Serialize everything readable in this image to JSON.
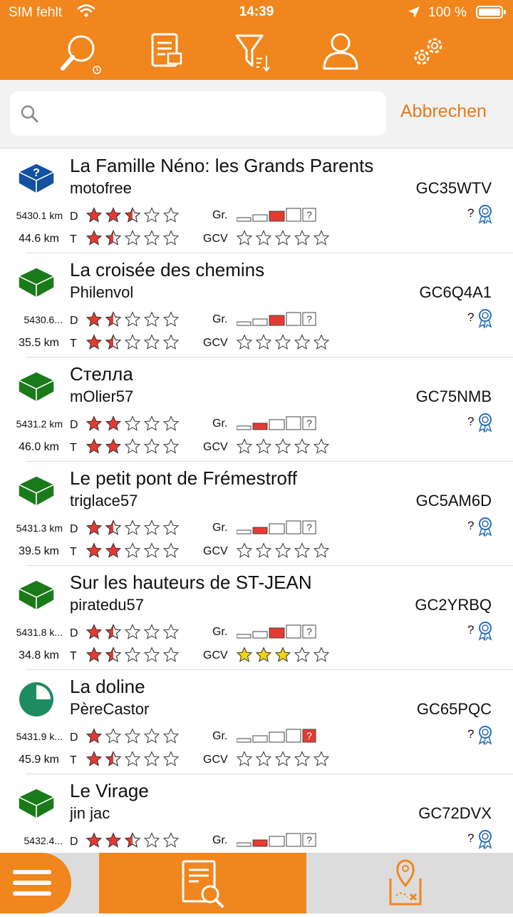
{
  "status": {
    "carrier": "SIM fehlt",
    "time": "14:39",
    "battery": "100 %"
  },
  "toolbar": {
    "buttons": [
      "search-history-icon",
      "cache-list-icon",
      "filter-sort-icon",
      "user-icon",
      "settings-icon"
    ]
  },
  "search": {
    "value": "",
    "placeholder": "",
    "cancel_label": "Abbrechen"
  },
  "labels": {
    "difficulty": "D",
    "terrain": "T",
    "size": "Gr.",
    "gcvote": "GCV",
    "favorites": "?"
  },
  "colors": {
    "accent": "#f0861d",
    "star_red": "#e53a32",
    "star_yellow": "#f2d414",
    "traditional": "#1a7a1a",
    "mystery": "#1451a0",
    "virtual": "#1e8c61"
  },
  "caches": [
    {
      "name": "La Famille Néno: les Grands Parents",
      "owner": "motofree",
      "code": "GC35WTV",
      "distance": "5430.1 km",
      "distance2": "44.6 km",
      "type": "mystery",
      "difficulty": 2.5,
      "terrain": 1.5,
      "size_level": 2,
      "size_unknown_red": false,
      "gcvote": 0
    },
    {
      "name": "La croisée des chemins",
      "owner": "Philenvol",
      "code": "GC6Q4A1",
      "distance": "5430.6...",
      "distance2": "35.5 km",
      "type": "traditional",
      "difficulty": 1.5,
      "terrain": 1.5,
      "size_level": 2,
      "size_unknown_red": false,
      "gcvote": 0
    },
    {
      "name": "Стелла",
      "owner": "mOlier57",
      "code": "GC75NMB",
      "distance": "5431.2 km",
      "distance2": "46.0 km",
      "type": "traditional",
      "difficulty": 2,
      "terrain": 2,
      "size_level": 1,
      "size_unknown_red": false,
      "gcvote": 0
    },
    {
      "name": "Le petit pont de Frémestroff",
      "owner": "triglace57",
      "code": "GC5AM6D",
      "distance": "5431.3 km",
      "distance2": "39.5 km",
      "type": "traditional",
      "difficulty": 1.5,
      "terrain": 2,
      "size_level": 1,
      "size_unknown_red": false,
      "gcvote": 0
    },
    {
      "name": "Sur les hauteurs de ST-JEAN",
      "owner": "piratedu57",
      "code": "GC2YRBQ",
      "distance": "5431.8 k...",
      "distance2": "34.8 km",
      "type": "traditional",
      "difficulty": 1.5,
      "terrain": 1.5,
      "size_level": 2,
      "size_unknown_red": false,
      "gcvote": 3
    },
    {
      "name": "La doline",
      "owner": "PèreCastor",
      "code": "GC65PQC",
      "distance": "5431.9 k...",
      "distance2": "45.9 km",
      "type": "virtual",
      "difficulty": 1,
      "terrain": 1.5,
      "size_level": 0,
      "size_unknown_red": true,
      "gcvote": 0
    },
    {
      "name": "Le Virage",
      "owner": "jin jac",
      "code": "GC72DVX",
      "distance": "5432.4...",
      "distance2": "",
      "type": "traditional",
      "difficulty": 2.5,
      "terrain": 0,
      "size_level": 1,
      "size_unknown_red": false,
      "gcvote": 0
    }
  ]
}
